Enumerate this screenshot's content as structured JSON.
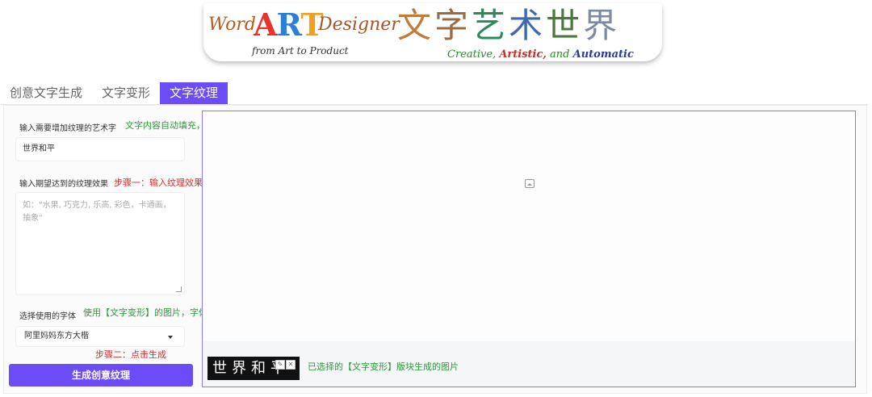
{
  "banner": {
    "word": "Word",
    "art_a": "A",
    "art_r": "R",
    "art_t": "T",
    "designer": "Designer",
    "subtitle": "from Art to Product",
    "cn_chars": [
      "文",
      "字",
      "艺",
      "术",
      "世",
      "界"
    ],
    "tag_creative": "Creative,",
    "tag_artistic": "Artistic,",
    "tag_and": " and ",
    "tag_automatic": "Automatic"
  },
  "tabs": [
    {
      "label": "创意文字生成"
    },
    {
      "label": "文字变形"
    },
    {
      "label": "文字纹理"
    }
  ],
  "form": {
    "text_label": "输入需要增加纹理的艺术字",
    "text_note": "文字内容自动填充，无需修改",
    "text_value": "世界和平",
    "effect_label": "输入期望达到的纹理效果",
    "effect_note": "步骤一：输入纹理效果描述",
    "effect_placeholder": "如：\"水果, 巧克力, 乐高, 彩色，卡通画，抽象\"",
    "font_label": "选择使用的字体",
    "font_note": "使用【文字变形】的图片，字体选择不起作用",
    "font_value": "阿里妈妈东方大楷",
    "step2_note": "步骤二：点击生成",
    "generate_label": "生成创意纹理"
  },
  "output": {
    "thumb_text": "世界和平",
    "thumb_caption": "已选择的【文字变形】版块生成的图片"
  }
}
